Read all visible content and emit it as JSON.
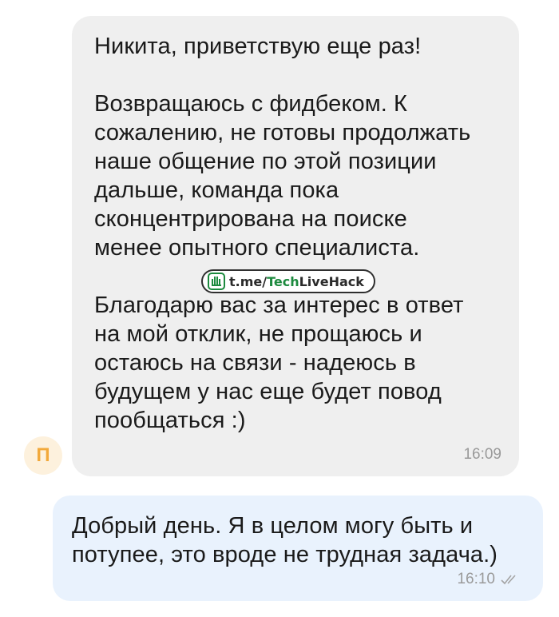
{
  "incoming_message": {
    "text": "Никита, приветствую еще раз!\n\nВозвращаюсь с фидбеком. К\nсожалению, не готовы продолжать\nнаше общение по этой позиции\nдальше, команда пока\nсконцентрирована на поиске\nменее опытного специалиста.\n\nБлагодарю вас за интерес в ответ\nна мой отклик, не прощаюсь и\nостаюсь на связи - надеюсь в\nбудущем у нас еще будет повод\nпообщаться :)",
    "time": "16:09",
    "avatar_letter": "П",
    "avatar_color": "#f2a93b"
  },
  "watermark": {
    "part1": "t.me/",
    "part2": "Tech",
    "part3": "LiveHack",
    "logo_icon": "green-hand-logo"
  },
  "outgoing_message": {
    "text": "Добрый день. Я в целом могу быть и\nпотупее, это вроде не трудная задача.)",
    "time": "16:10",
    "status_icon": "double-check-read"
  },
  "colors": {
    "incoming_bubble": "#efefef",
    "outgoing_bubble": "#e9f2fd",
    "timestamp": "#9a9a9a",
    "watermark_green": "#1c8a3e"
  }
}
